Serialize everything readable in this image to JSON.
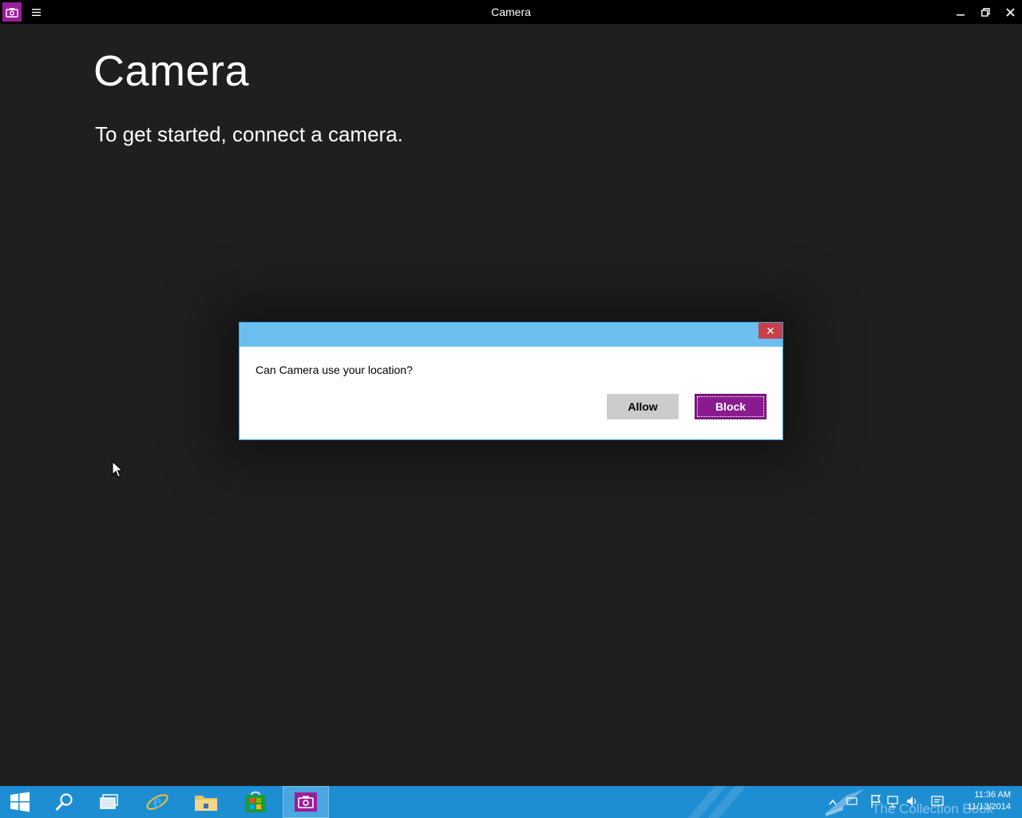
{
  "window": {
    "title": "Camera",
    "app_icon": "camera-icon",
    "menu_icon": "hamburger-icon",
    "controls": [
      "minimize-icon",
      "restore-icon",
      "close-icon"
    ]
  },
  "main": {
    "heading": "Camera",
    "message": "To get started, connect a camera."
  },
  "dialog": {
    "question": "Can Camera use your location?",
    "allow_label": "Allow",
    "block_label": "Block",
    "header_color": "#6bbfef",
    "accent": "#8a1b8f"
  },
  "taskbar": {
    "items": [
      "start-icon",
      "search-icon",
      "task-view-icon",
      "internet-explorer-icon",
      "file-explorer-icon",
      "store-icon",
      "camera-icon"
    ],
    "active_item": "camera-icon",
    "watermark": "The Collection Book",
    "clock": {
      "time": "11:36 AM",
      "date": "11/13/2014"
    }
  }
}
